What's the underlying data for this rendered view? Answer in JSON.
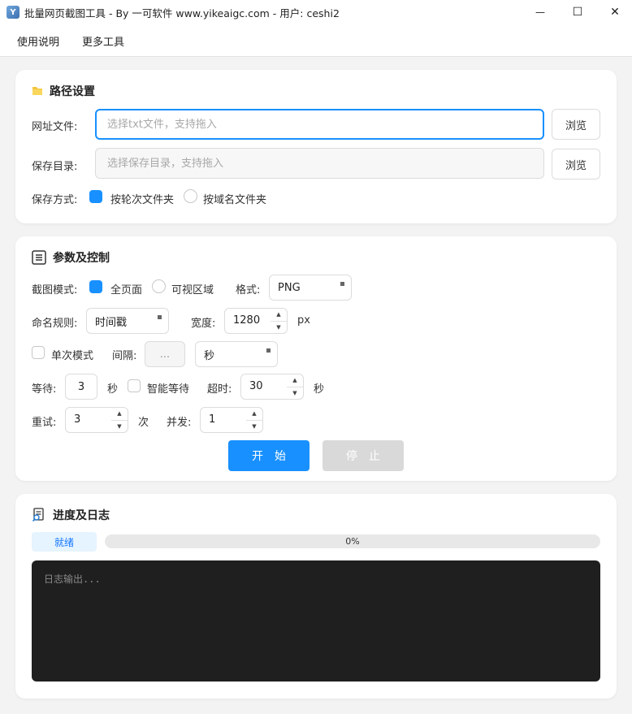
{
  "window": {
    "app_icon_text": "Y",
    "title": "批量网页截图工具 - By 一可软件 www.yikeaigc.com - 用户: ceshi2",
    "minimize_glyph": "—",
    "maximize_glyph": "☐",
    "close_glyph": "✕"
  },
  "menu": {
    "items": [
      "使用说明",
      "更多工具"
    ]
  },
  "path_section": {
    "title": "路径设置",
    "url_file": {
      "label": "网址文件:",
      "placeholder": "选择txt文件，支持拖入",
      "value": "",
      "browse": "浏览"
    },
    "save_dir": {
      "label": "保存目录:",
      "placeholder": "选择保存目录，支持拖入",
      "value": "",
      "browse": "浏览"
    },
    "save_mode": {
      "label": "保存方式:",
      "options": [
        {
          "label": "按轮次文件夹",
          "checked": true
        },
        {
          "label": "按域名文件夹",
          "checked": false
        }
      ]
    }
  },
  "params_section": {
    "title": "参数及控制",
    "capture_mode": {
      "label": "截图模式:",
      "options": [
        {
          "label": "全页面",
          "checked": true
        },
        {
          "label": "可视区域",
          "checked": false
        }
      ]
    },
    "format": {
      "label": "格式:",
      "value": "PNG"
    },
    "naming": {
      "label": "命名规则:",
      "value": "时间戳"
    },
    "width": {
      "label": "宽度:",
      "value": "1280",
      "unit": "px"
    },
    "single_mode": {
      "label": "单次模式",
      "checked": false
    },
    "interval": {
      "label": "间隔:",
      "value": "...",
      "unit": "秒"
    },
    "wait": {
      "label": "等待:",
      "value": "3",
      "unit": "秒"
    },
    "smart_wait": {
      "label": "智能等待",
      "checked": false
    },
    "timeout": {
      "label": "超时:",
      "value": "30",
      "unit": "秒"
    },
    "retry": {
      "label": "重试:",
      "value": "3",
      "unit": "次"
    },
    "concurrency": {
      "label": "并发:",
      "value": "1"
    },
    "spin_up_glyph": "▲",
    "spin_down_glyph": "▼",
    "start_label": "开始",
    "stop_label": "停止"
  },
  "log_section": {
    "title": "进度及日志",
    "status": "就绪",
    "progress_percent": 0,
    "progress_text": "0%",
    "log_placeholder": "日志输出..."
  },
  "colors": {
    "accent": "#1890ff",
    "log_bg": "#1f1f1f",
    "status_bg": "#e6f4ff"
  }
}
